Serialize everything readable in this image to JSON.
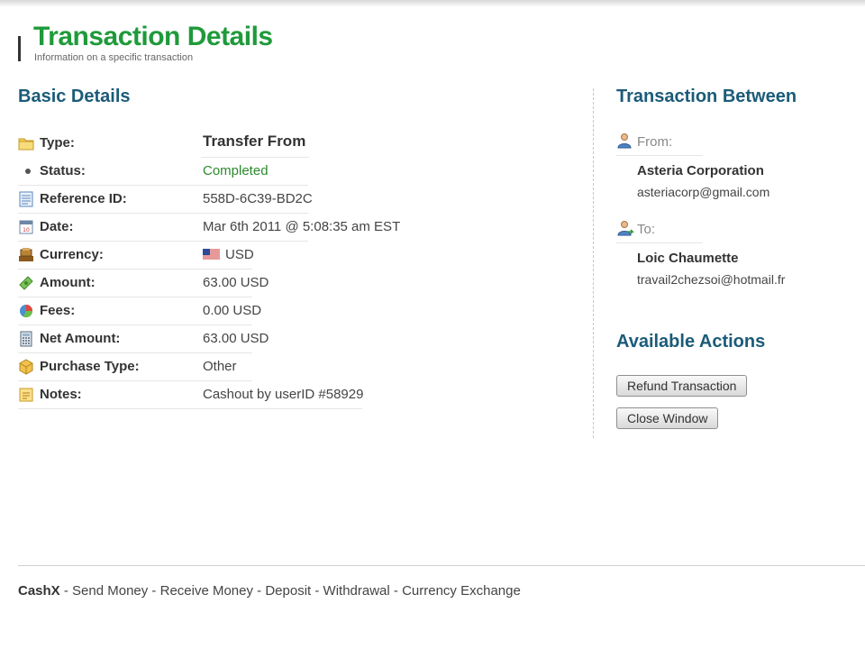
{
  "header": {
    "title": "Transaction Details",
    "subtitle": "Information on a specific transaction"
  },
  "basic": {
    "heading": "Basic Details",
    "rows": [
      {
        "icon": "folder-icon",
        "label": "Type:",
        "value": "Transfer From"
      },
      {
        "icon": "bullet-icon",
        "label": "Status:",
        "value": "Completed"
      },
      {
        "icon": "document-icon",
        "label": "Reference ID:",
        "value": "558D-6C39-BD2C"
      },
      {
        "icon": "calendar-icon",
        "label": "Date:",
        "value": "Mar 6th 2011 @ 5:08:35 am EST"
      },
      {
        "icon": "cash-register-icon",
        "label": "Currency:",
        "value": "USD"
      },
      {
        "icon": "money-icon",
        "label": "Amount:",
        "value": "63.00 USD"
      },
      {
        "icon": "pie-chart-icon",
        "label": "Fees:",
        "value": "0.00 USD"
      },
      {
        "icon": "calculator-icon",
        "label": "Net Amount:",
        "value": "63.00 USD"
      },
      {
        "icon": "box-icon",
        "label": "Purchase Type:",
        "value": "Other"
      },
      {
        "icon": "note-icon",
        "label": "Notes:",
        "value": "Cashout by userID #58929"
      }
    ],
    "currency_flag": "us-flag-icon"
  },
  "between": {
    "heading": "Transaction Between",
    "from_label": "From:",
    "from_name": "Asteria Corporation",
    "from_email": "asteriacorp@gmail.com",
    "to_label": "To:",
    "to_name": "Loic Chaumette",
    "to_email": "travail2chezsoi@hotmail.fr"
  },
  "actions": {
    "heading": "Available Actions",
    "refund": "Refund Transaction",
    "close": "Close Window"
  },
  "footer": {
    "brand": "CashX",
    "sep": " - ",
    "links": [
      "Send Money",
      "Receive Money",
      "Deposit",
      "Withdrawal",
      "Currency Exchange"
    ]
  },
  "colors": {
    "title_green": "#1f9a3a",
    "heading_blue": "#1b5b78",
    "status_green": "#2c8a2c"
  }
}
